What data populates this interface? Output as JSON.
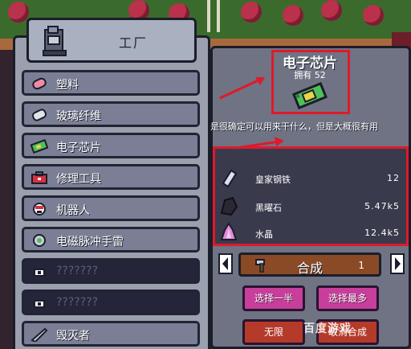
{
  "factory": {
    "title": "工厂",
    "recipes": [
      {
        "label": "塑料",
        "icon": "plastic-icon",
        "locked": false
      },
      {
        "label": "玻璃纤维",
        "icon": "fiberglass-icon",
        "locked": false
      },
      {
        "label": "电子芯片",
        "icon": "chip-icon",
        "locked": false
      },
      {
        "label": "修理工具",
        "icon": "toolbox-icon",
        "locked": false
      },
      {
        "label": "机器人",
        "icon": "robot-icon",
        "locked": false
      },
      {
        "label": "电磁脉冲手雷",
        "icon": "emp-grenade-icon",
        "locked": false
      },
      {
        "label": "???????",
        "icon": "lock-icon",
        "locked": true
      },
      {
        "label": "???????",
        "icon": "lock-icon",
        "locked": true
      },
      {
        "label": "毁灭者",
        "icon": "destroyer-icon",
        "locked": false
      }
    ]
  },
  "detail": {
    "name": "电子芯片",
    "owned": "拥有 52",
    "description": "是很确定可以用来干什么，但是大概很有用",
    "materials": [
      {
        "name": "皇家钢铁",
        "qty": "12",
        "icon": "royal-steel-icon"
      },
      {
        "name": "黑曜石",
        "qty": "5.47k5",
        "icon": "obsidian-icon"
      },
      {
        "name": "水晶",
        "qty": "12.4k5",
        "icon": "crystal-icon"
      }
    ],
    "craft_label": "合成",
    "craft_count": "1",
    "buttons": {
      "half": "选择一半",
      "max": "选择最多",
      "infinite": "无限",
      "cancel": "取消合成"
    }
  },
  "watermark": "百度游戏",
  "colors": {
    "annotation_red": "#e0192b",
    "craft_bar": "#8b4a26",
    "pink_button": "#c73f9b",
    "panel_gray": "#9aa0ad"
  }
}
